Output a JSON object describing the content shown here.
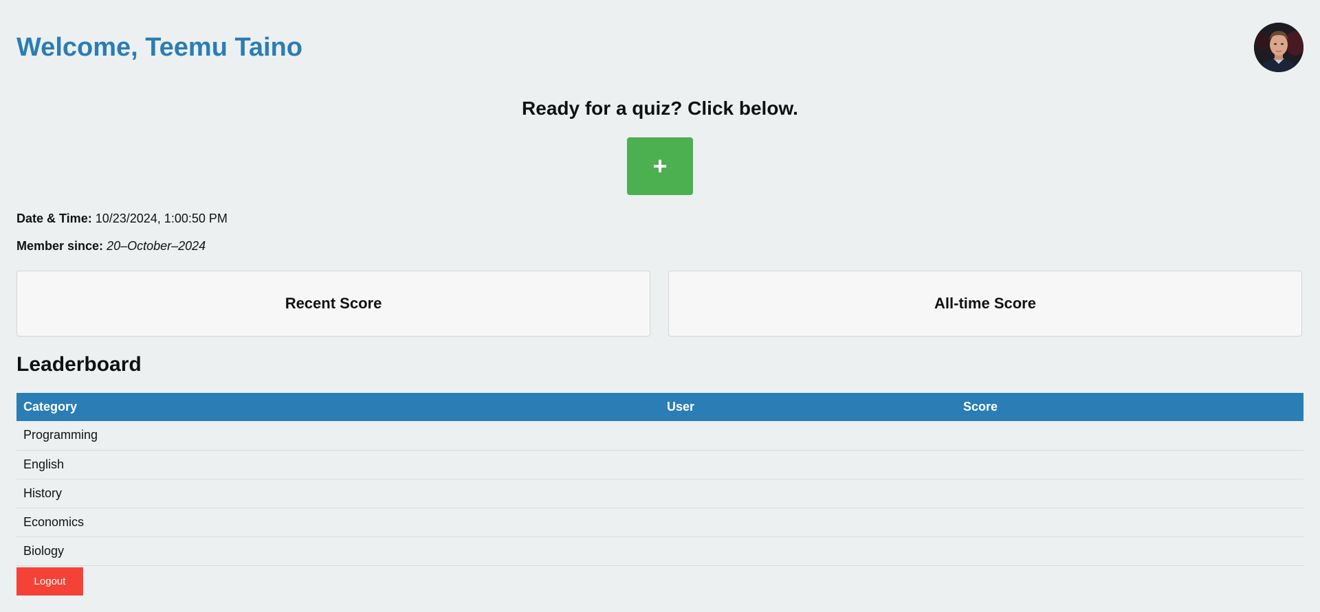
{
  "header": {
    "welcome": "Welcome, Teemu Taino",
    "avatar_icon": "user-avatar-photo"
  },
  "quiz": {
    "prompt": "Ready for a quiz? Click below.",
    "start_label": "+"
  },
  "info": {
    "datetime_label": "Date & Time:",
    "datetime_value": "10/23/2024, 1:00:50 PM",
    "member_label": "Member since:",
    "member_value": "20–October–2024"
  },
  "scores": {
    "recent_label": "Recent Score",
    "alltime_label": "All-time Score"
  },
  "leaderboard": {
    "title": "Leaderboard",
    "columns": [
      "Category",
      "User",
      "Score"
    ],
    "rows": [
      {
        "category": "Programming",
        "user": "",
        "score": ""
      },
      {
        "category": "English",
        "user": "",
        "score": ""
      },
      {
        "category": "History",
        "user": "",
        "score": ""
      },
      {
        "category": "Economics",
        "user": "",
        "score": ""
      },
      {
        "category": "Biology",
        "user": "",
        "score": ""
      }
    ]
  },
  "logout_label": "Logout",
  "colors": {
    "accent": "#2a7db5",
    "start_button": "#4caf50",
    "logout_button": "#f44336",
    "background": "#ecf0f1"
  }
}
